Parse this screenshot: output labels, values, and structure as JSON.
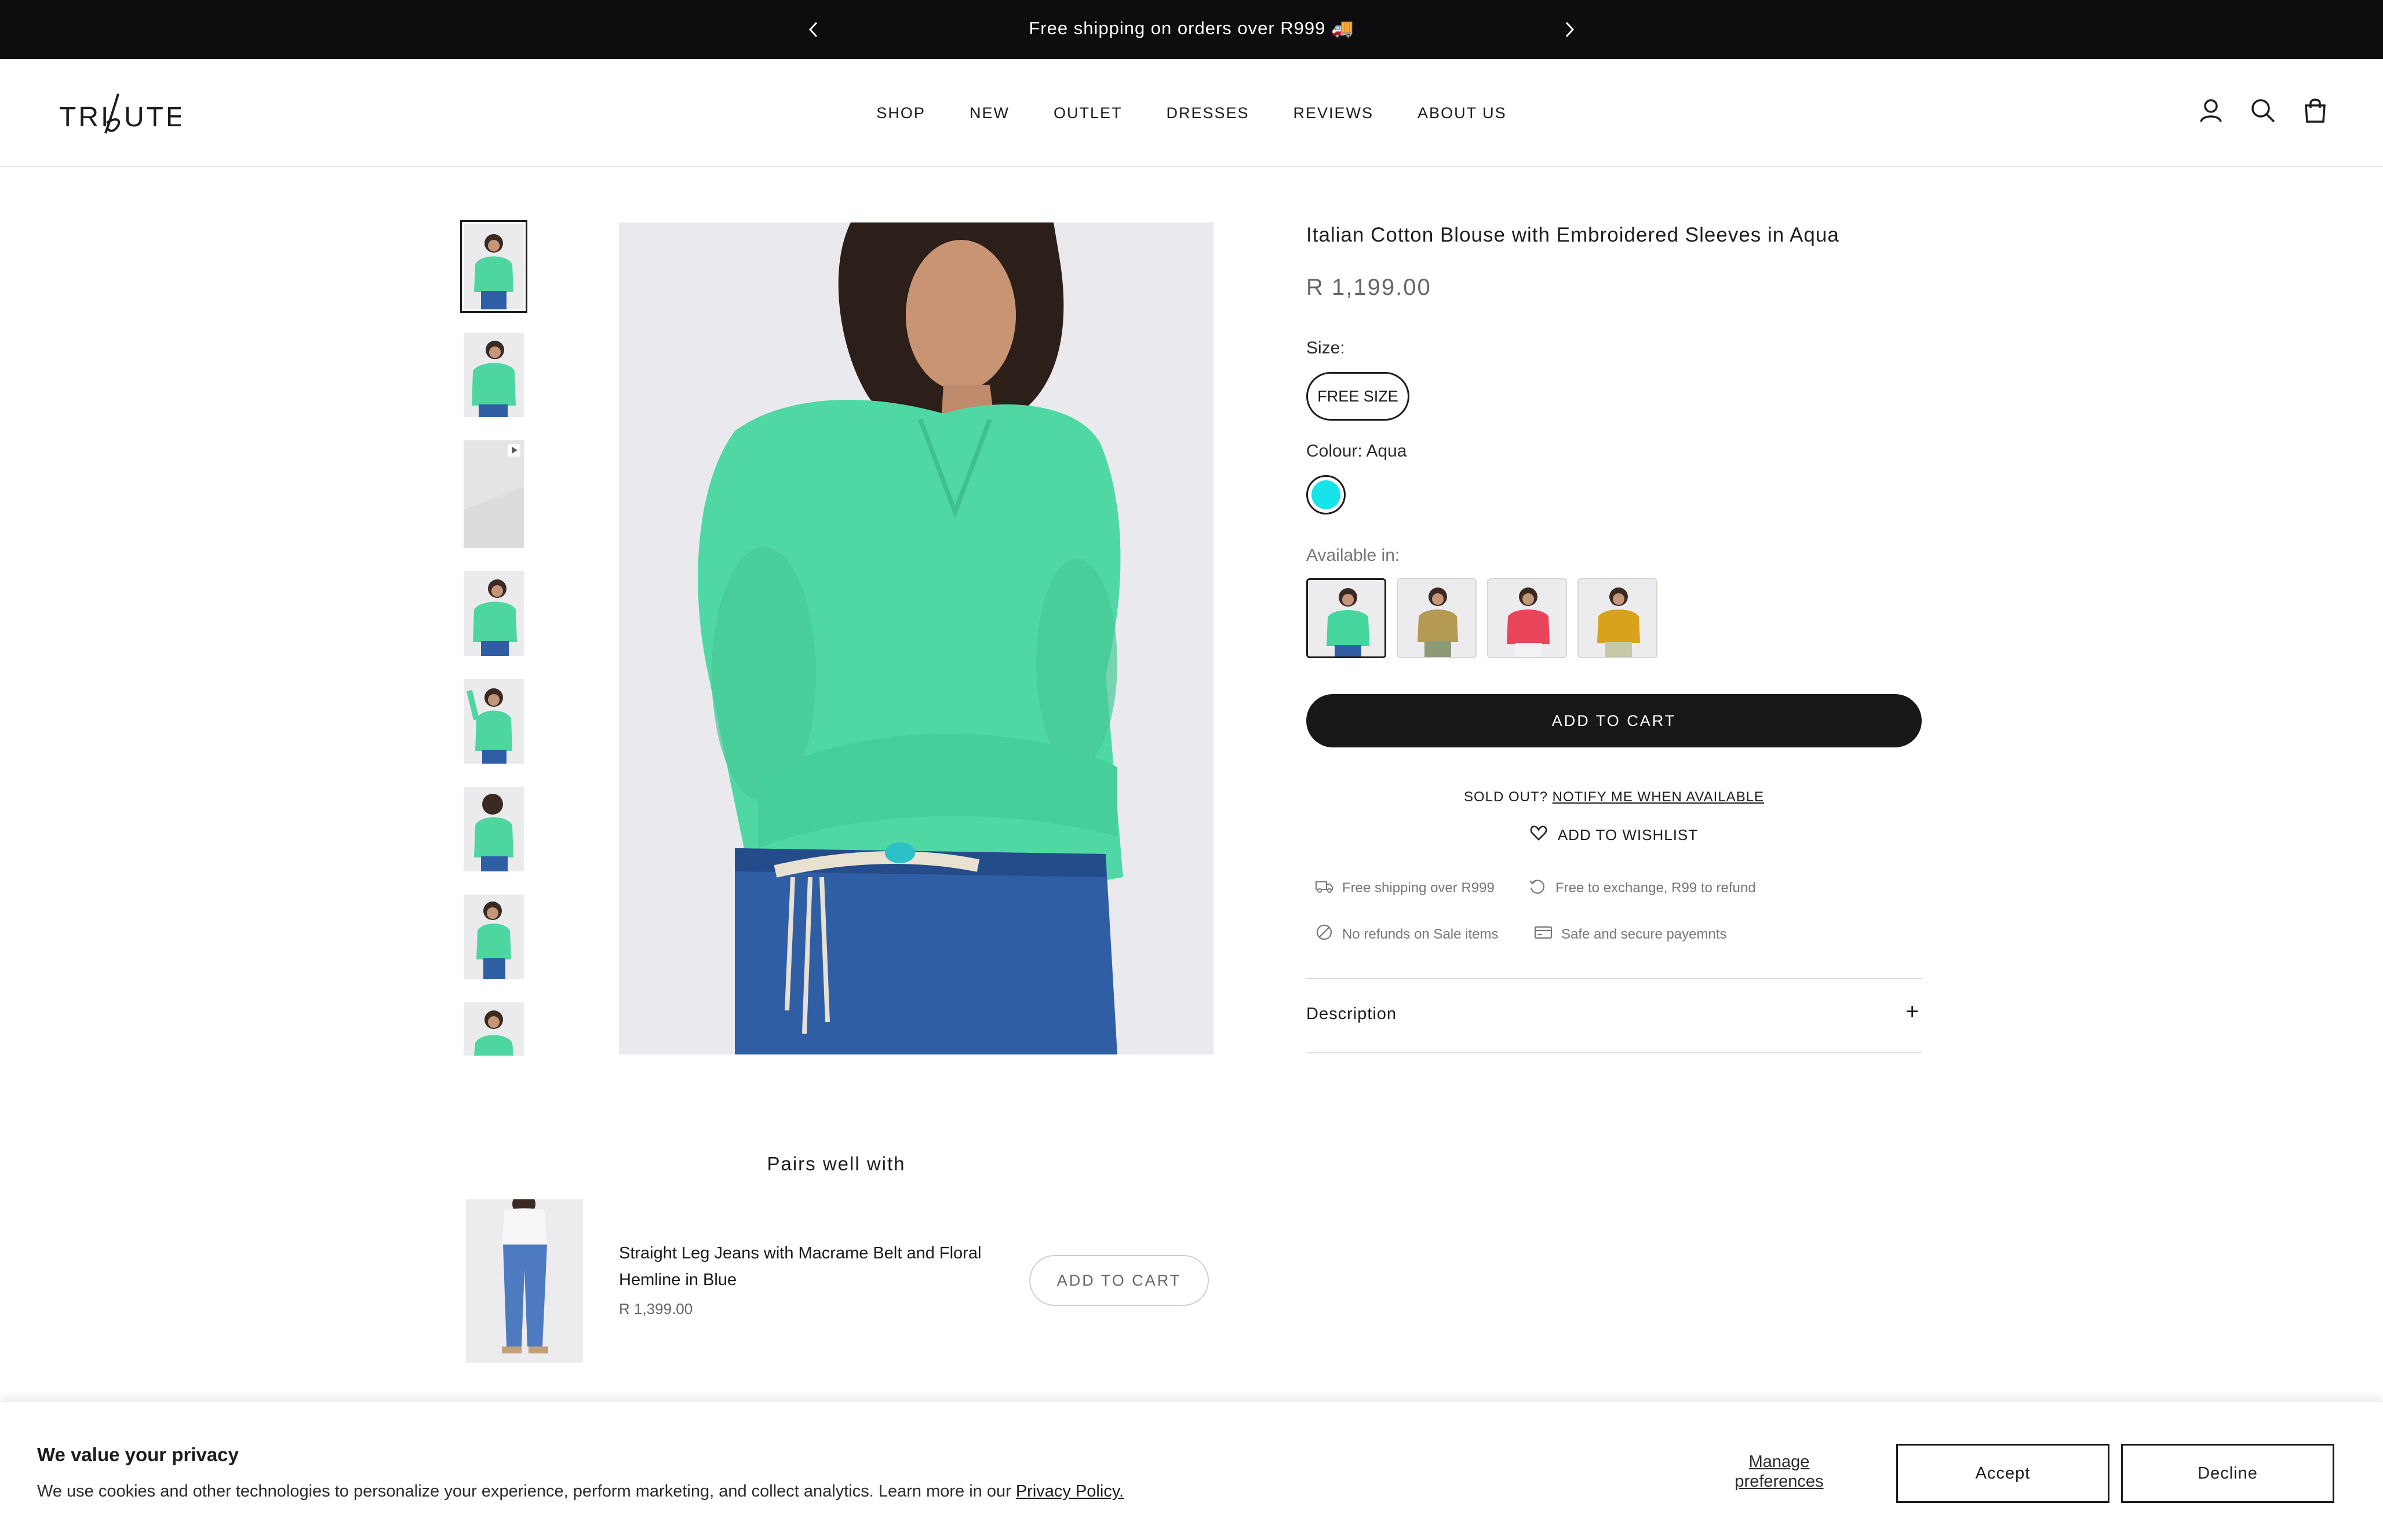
{
  "announcement": {
    "text": "Free shipping on orders over R999 🚚"
  },
  "brand": {
    "logo_text": "TRIBUTE"
  },
  "nav": {
    "items": [
      "SHOP",
      "NEW",
      "OUTLET",
      "DRESSES",
      "REVIEWS",
      "ABOUT US"
    ]
  },
  "header_icons": [
    "account-icon",
    "search-icon",
    "bag-icon"
  ],
  "gallery": {
    "thumbnail_count": 8,
    "selected_index": 0,
    "video_thumbnail_index": 2
  },
  "product": {
    "title": "Italian Cotton Blouse with Embroidered Sleeves in Aqua",
    "price": "R 1,199.00",
    "size_label": "Size:",
    "size_value": "FREE SIZE",
    "colour_label": "Colour: Aqua",
    "colour_hex": "#16e3ea",
    "available_label": "Available in:",
    "variants": [
      {
        "name": "aqua",
        "color": "#45d69e"
      },
      {
        "name": "olive",
        "color": "#b49a52"
      },
      {
        "name": "coral",
        "color": "#e8445a"
      },
      {
        "name": "mustard",
        "color": "#d9a21c"
      }
    ],
    "add_to_cart": "ADD TO CART",
    "sold_out_text": "SOLD OUT?",
    "notify_link": "NOTIFY ME WHEN AVAILABLE",
    "wishlist": "ADD TO WISHLIST",
    "features": [
      "Free shipping over R999",
      "Free to exchange, R99 to refund",
      "No refunds on Sale items",
      "Safe and secure payemnts"
    ],
    "description_label": "Description",
    "description_toggle": "+"
  },
  "pairs": {
    "title": "Pairs well with",
    "name": "Straight Leg Jeans with Macrame Belt and Floral Hemline in Blue",
    "price": "R 1,399.00",
    "button": "ADD TO CART"
  },
  "cookie": {
    "title": "We value your privacy",
    "text": "We use cookies and other technologies to personalize your experience, perform marketing, and collect analytics. Learn more in our",
    "policy_link": "Privacy Policy.",
    "manage": "Manage preferences",
    "accept": "Accept",
    "decline": "Decline"
  }
}
